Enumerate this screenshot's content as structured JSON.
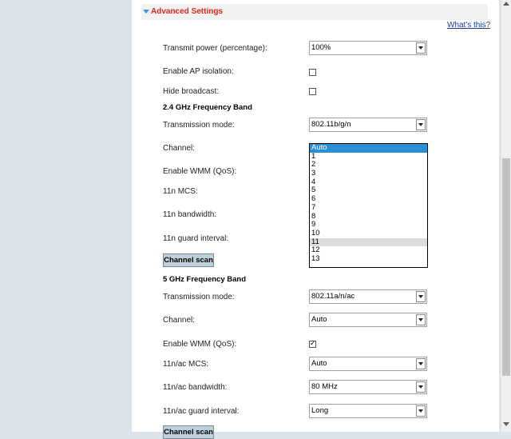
{
  "section": {
    "title": "Advanced Settings",
    "help_link": "What's this?"
  },
  "general": {
    "transmit_power_label": "Transmit power (percentage):",
    "transmit_power_value": "100%",
    "ap_isolation_label": "Enable AP isolation:",
    "ap_isolation_checked": false,
    "hide_broadcast_label": "Hide broadcast:",
    "hide_broadcast_checked": false
  },
  "band24": {
    "title": "2.4 GHz Frequency Band",
    "transmission_mode_label": "Transmission mode:",
    "transmission_mode_value": "802.11b/g/n",
    "channel_label": "Channel:",
    "wmm_label": "Enable WMM (QoS):",
    "mcs_label": "11n MCS:",
    "bandwidth_label": "11n bandwidth:",
    "guard_label": "11n guard interval:",
    "scan_button": "Channel scan",
    "channel_options": [
      "Auto",
      "1",
      "2",
      "3",
      "4",
      "5",
      "6",
      "7",
      "8",
      "9",
      "10",
      "11",
      "12",
      "13"
    ],
    "channel_selected": "Auto",
    "channel_hovered": "11"
  },
  "band5": {
    "title": "5 GHz Frequency Band",
    "transmission_mode_label": "Transmission mode:",
    "transmission_mode_value": "802.11a/n/ac",
    "channel_label": "Channel:",
    "channel_value": "Auto",
    "wmm_label": "Enable WMM (QoS):",
    "wmm_checked": true,
    "mcs_label": "11n/ac MCS:",
    "mcs_value": "Auto",
    "bandwidth_label": "11n/ac bandwidth:",
    "bandwidth_value": "80 MHz",
    "guard_label": "11n/ac guard interval:",
    "guard_value": "Long",
    "scan_button": "Channel scan"
  },
  "colors": {
    "accent_red": "#e0261c",
    "selection_blue": "#2b8fd6",
    "button_bg": "#bfd0dd"
  }
}
